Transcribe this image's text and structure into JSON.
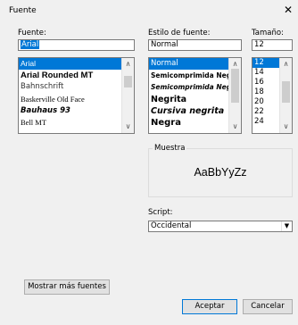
{
  "window": {
    "title": "Fuente",
    "close_glyph": "✕"
  },
  "font": {
    "label": "Fuente:",
    "value": "Arial",
    "items": [
      "Arial",
      "Arial Rounded MT",
      "Bahnschrift",
      "Baskerville Old Face",
      "Bauhaus 93",
      "Bell MT"
    ]
  },
  "style": {
    "label": "Estilo de fuente:",
    "value": "Normal",
    "items": [
      "Normal",
      "Semicomprimida Neg",
      "Semicomprimida Neg",
      "Negrita",
      "Cursiva negrita",
      "Negra"
    ]
  },
  "size": {
    "label": "Tamaño:",
    "value": "12",
    "items": [
      "12",
      "14",
      "16",
      "18",
      "20",
      "22",
      "24"
    ]
  },
  "sample": {
    "label": "Muestra",
    "text": "AaBbYyZz"
  },
  "script": {
    "label": "Script:",
    "value": "Occidental"
  },
  "buttons": {
    "more_fonts": "Mostrar más fuentes",
    "ok": "Aceptar",
    "cancel": "Cancelar"
  },
  "colors": {
    "selection": "#0078d7",
    "background": "#f0f0f0"
  }
}
